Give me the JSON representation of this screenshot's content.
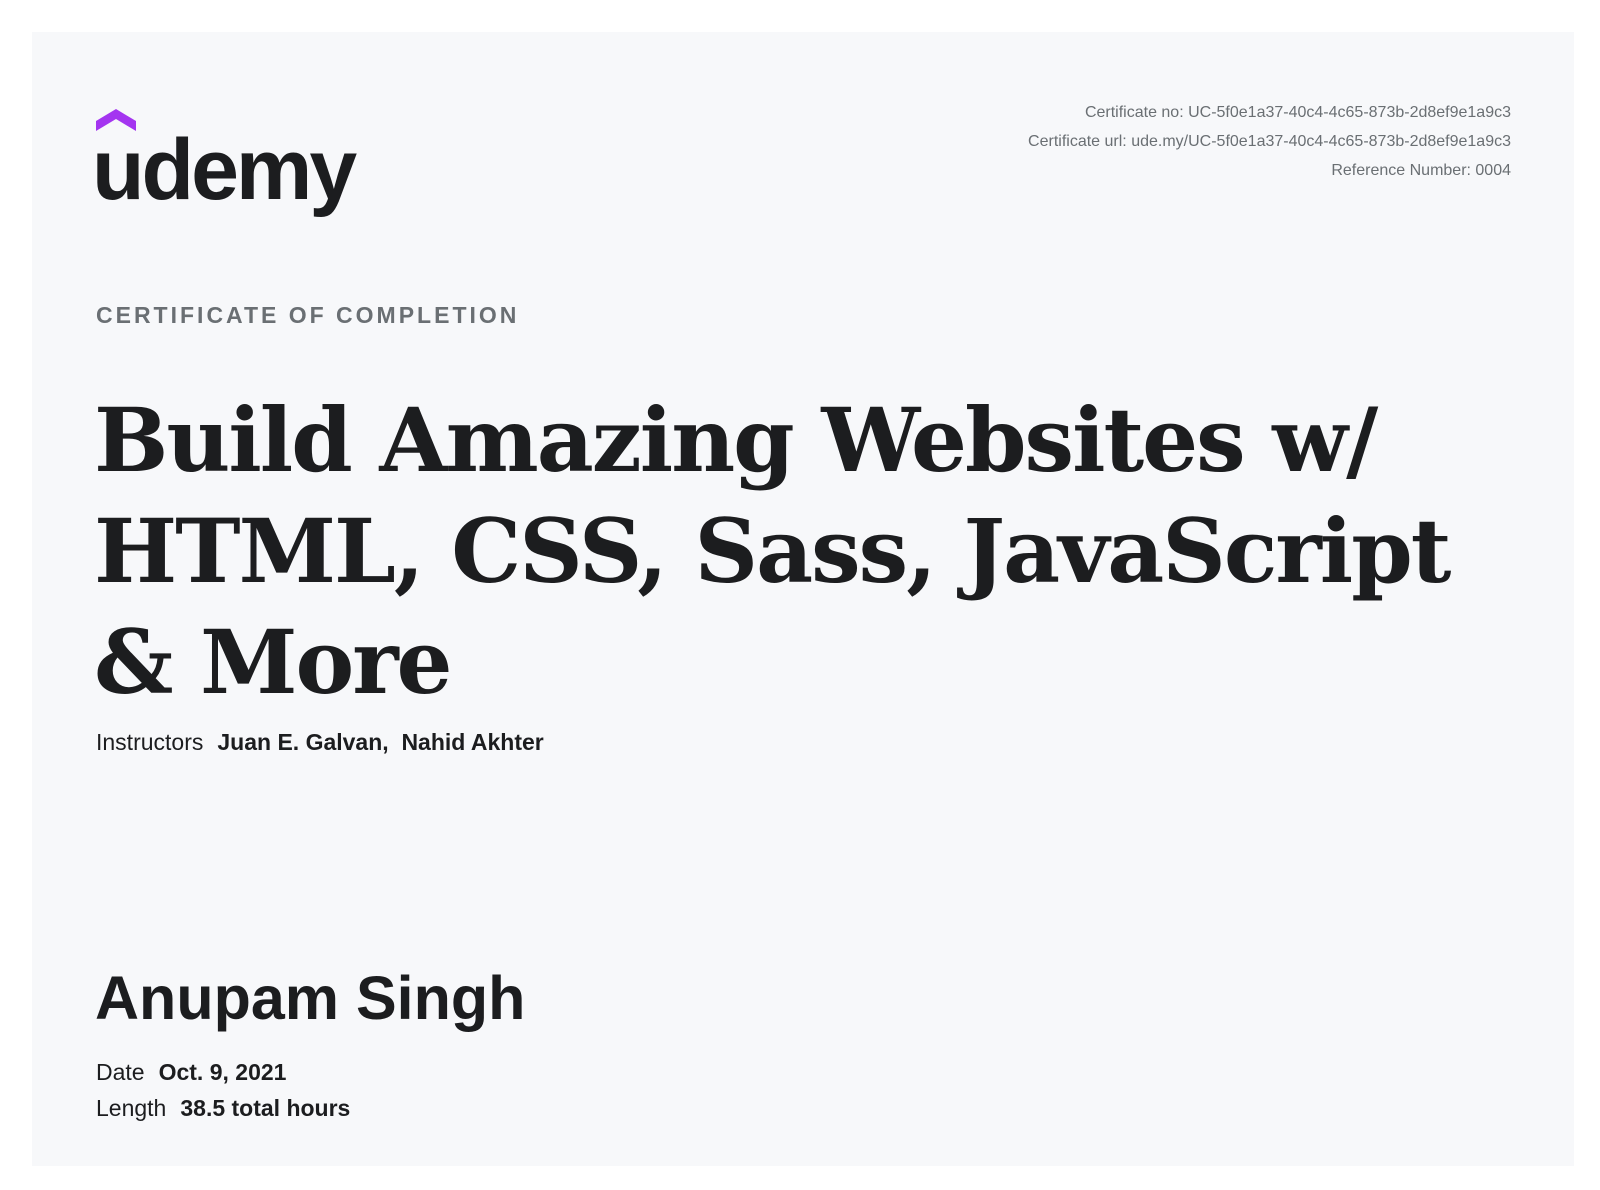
{
  "logo": {
    "wordmark": "udemy",
    "accent_color": "#a435f0",
    "text_color": "#1c1d1f"
  },
  "certificate_meta": {
    "certificate_no": "Certificate no: UC-5f0e1a37-40c4-4c65-873b-2d8ef9e1a9c3",
    "certificate_url": "Certificate url: ude.my/UC-5f0e1a37-40c4-4c65-873b-2d8ef9e1a9c3",
    "reference_number": "Reference Number: 0004"
  },
  "kicker": "CERTIFICATE OF COMPLETION",
  "course_title": "Build Amazing Websites w/ HTML, CSS, Sass, JavaScript & More",
  "instructors": {
    "label": "Instructors",
    "names": "Juan E. Galvan,  Nahid Akhter"
  },
  "recipient": "Anupam Singh",
  "date": {
    "label": "Date",
    "value": "Oct. 9, 2021"
  },
  "length": {
    "label": "Length",
    "value": "38.5 total hours"
  },
  "colors": {
    "page_background": "#ffffff",
    "card_background": "#f7f8fa",
    "primary_text": "#1c1d1f",
    "secondary_text": "#6a6f73",
    "brand_accent": "#a435f0"
  }
}
